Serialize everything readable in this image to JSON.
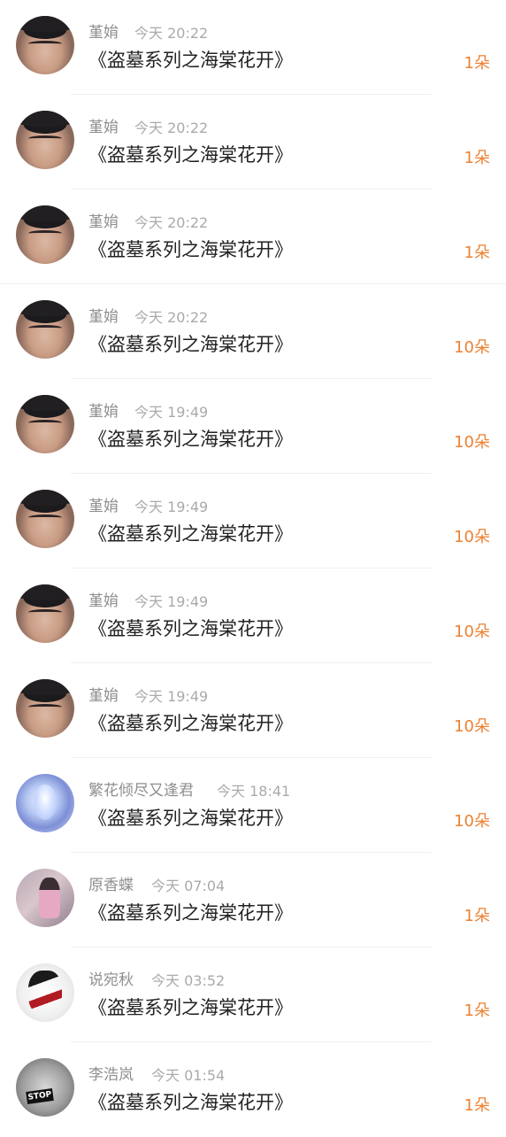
{
  "gift_list": {
    "items": [
      {
        "name": "堇姢",
        "time": "今天 20:22",
        "title": "《盗墓系列之海棠花开》",
        "count": "1朵",
        "avatar": "face"
      },
      {
        "name": "堇姢",
        "time": "今天 20:22",
        "title": "《盗墓系列之海棠花开》",
        "count": "1朵",
        "avatar": "face"
      },
      {
        "name": "堇姢",
        "time": "今天 20:22",
        "title": "《盗墓系列之海棠花开》",
        "count": "1朵",
        "avatar": "face"
      },
      {
        "name": "堇姢",
        "time": "今天 20:22",
        "title": "《盗墓系列之海棠花开》",
        "count": "10朵",
        "avatar": "face"
      },
      {
        "name": "堇姢",
        "time": "今天 19:49",
        "title": "《盗墓系列之海棠花开》",
        "count": "10朵",
        "avatar": "face"
      },
      {
        "name": "堇姢",
        "time": "今天 19:49",
        "title": "《盗墓系列之海棠花开》",
        "count": "10朵",
        "avatar": "face"
      },
      {
        "name": "堇姢",
        "time": "今天 19:49",
        "title": "《盗墓系列之海棠花开》",
        "count": "10朵",
        "avatar": "face"
      },
      {
        "name": "堇姢",
        "time": "今天 19:49",
        "title": "《盗墓系列之海棠花开》",
        "count": "10朵",
        "avatar": "face"
      },
      {
        "name": "繁花倾尽又逢君",
        "time": "今天 18:41",
        "title": "《盗墓系列之海棠花开》",
        "count": "10朵",
        "avatar": "anime1"
      },
      {
        "name": "原香蝶",
        "time": "今天 07:04",
        "title": "《盗墓系列之海棠花开》",
        "count": "1朵",
        "avatar": "anime2"
      },
      {
        "name": "说宛秋",
        "time": "今天 03:52",
        "title": "《盗墓系列之海棠花开》",
        "count": "1朵",
        "avatar": "anime3"
      },
      {
        "name": "李浩岚",
        "time": "今天 01:54",
        "title": "《盗墓系列之海棠花开》",
        "count": "1朵",
        "avatar": "bw"
      }
    ],
    "stop_sign_text": "STOP",
    "accent_color": "#ec8132"
  }
}
